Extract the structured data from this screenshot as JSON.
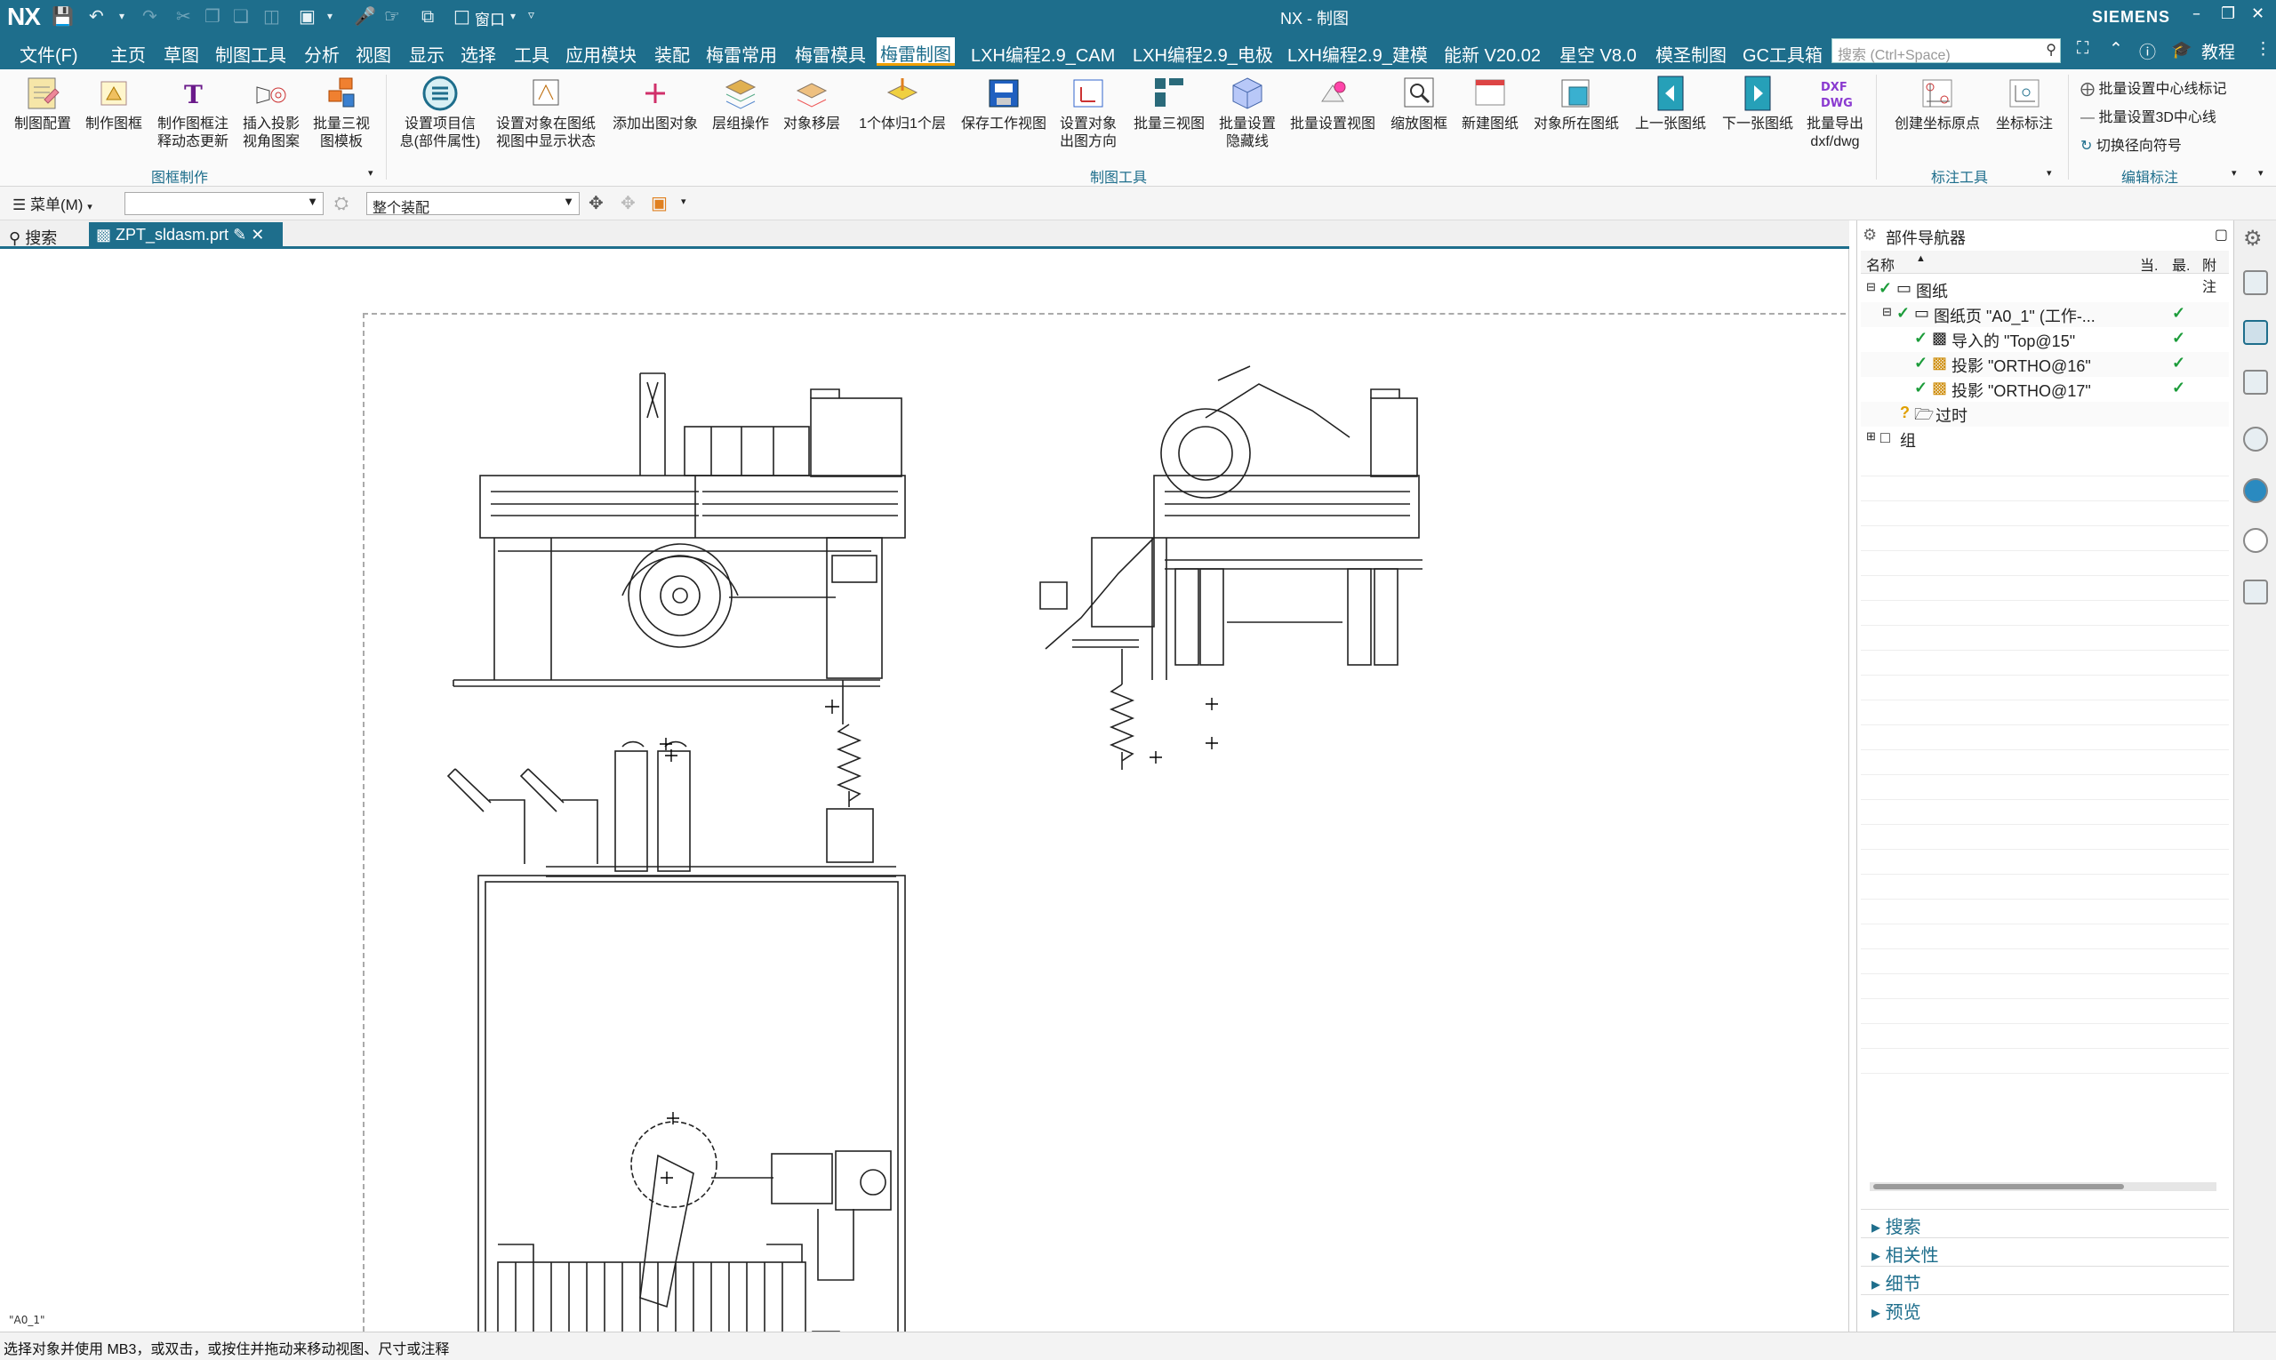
{
  "titlebar": {
    "logo": "NX",
    "window_title": "NX - 制图",
    "window_menu": "窗口",
    "brand": "SIEMENS"
  },
  "menubar": {
    "items": [
      "文件(F)",
      "主页",
      "草图",
      "制图工具",
      "分析",
      "视图",
      "显示",
      "选择",
      "工具",
      "应用模块",
      "装配",
      "梅雷常用",
      "梅雷模具",
      "梅雷制图",
      "LXH编程2.9_CAM",
      "LXH编程2.9_电极",
      "LXH编程2.9_建模",
      "能新 V20.02",
      "星空 V8.0",
      "模圣制图",
      "GC工具箱"
    ],
    "active": "梅雷制图",
    "search_placeholder": "搜索 (Ctrl+Space)",
    "tutorial": "教程"
  },
  "ribbon": {
    "buttons": [
      {
        "label1": "制图配置",
        "label2": ""
      },
      {
        "label1": "制作图框",
        "label2": ""
      },
      {
        "label1": "制作图框注",
        "label2": "释动态更新"
      },
      {
        "label1": "插入投影",
        "label2": "视角图案"
      },
      {
        "label1": "批量三视",
        "label2": "图模板"
      },
      {
        "label1": "设置项目信",
        "label2": "息(部件属性)"
      },
      {
        "label1": "设置对象在图纸",
        "label2": "视图中显示状态"
      },
      {
        "label1": "添加出图对象",
        "label2": ""
      },
      {
        "label1": "层组操作",
        "label2": ""
      },
      {
        "label1": "对象移层",
        "label2": ""
      },
      {
        "label1": "1个体归1个层",
        "label2": ""
      },
      {
        "label1": "保存工作视图",
        "label2": ""
      },
      {
        "label1": "设置对象",
        "label2": "出图方向"
      },
      {
        "label1": "批量三视图",
        "label2": ""
      },
      {
        "label1": "批量设置",
        "label2": "隐藏线"
      },
      {
        "label1": "批量设置视图",
        "label2": ""
      },
      {
        "label1": "缩放图框",
        "label2": ""
      },
      {
        "label1": "新建图纸",
        "label2": ""
      },
      {
        "label1": "对象所在图纸",
        "label2": ""
      },
      {
        "label1": "上一张图纸",
        "label2": ""
      },
      {
        "label1": "下一张图纸",
        "label2": ""
      },
      {
        "label1": "批量导出",
        "label2": "dxf/dwg"
      },
      {
        "label1": "创建坐标原点",
        "label2": ""
      },
      {
        "label1": "坐标标注",
        "label2": ""
      }
    ],
    "groups": [
      "图框制作",
      "制图工具",
      "标注工具",
      "编辑标注"
    ],
    "small_commands": [
      "批量设置中心线标记",
      "批量设置3D中心线",
      "切换径向符号"
    ]
  },
  "selbar": {
    "menu": "菜单(M)",
    "filter_value": "",
    "scope": "整个装配"
  },
  "tabs": {
    "search": "搜索",
    "file": "ZPT_sldasm.prt"
  },
  "canvas": {
    "sheet_label": "\"A0_1\""
  },
  "navigator": {
    "title": "部件导航器",
    "columns": [
      "名称",
      "当.",
      "最.",
      "附注"
    ],
    "rows": [
      {
        "label": "图纸",
        "check": ""
      },
      {
        "label": "图纸页 \"A0_1\" (工作-...",
        "check": "✓"
      },
      {
        "label": "导入的 \"Top@15\"",
        "check": "✓"
      },
      {
        "label": "投影 \"ORTHO@16\"",
        "check": "✓"
      },
      {
        "label": "投影 \"ORTHO@17\"",
        "check": "✓"
      },
      {
        "label": "过时",
        "check": ""
      },
      {
        "label": "组",
        "check": ""
      }
    ],
    "sections": [
      "搜索",
      "相关性",
      "细节",
      "预览"
    ]
  },
  "status": {
    "text": "选择对象并使用 MB3，或双击，或按住并拖动来移动视图、尺寸或注释"
  },
  "colors": {
    "accent": "#1e6e8c",
    "active_tab_underline": "#f0a000",
    "check": "#1c9c3a"
  }
}
